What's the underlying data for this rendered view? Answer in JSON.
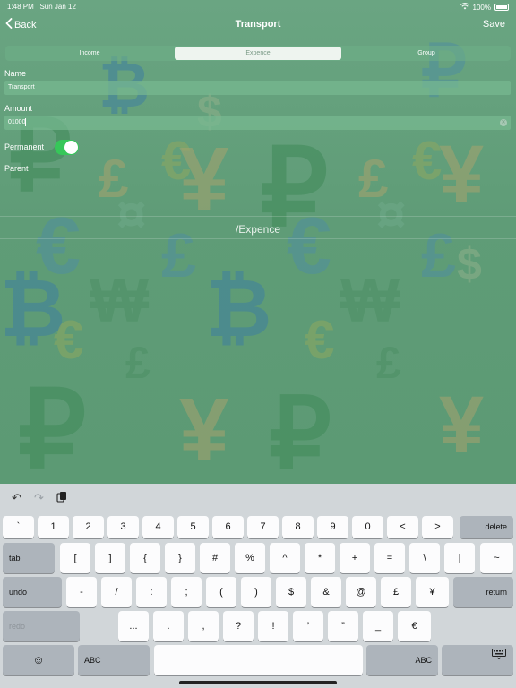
{
  "status": {
    "time": "1:48 PM",
    "date": "Sun Jan 12",
    "battery": "100%"
  },
  "nav": {
    "back_label": "Back",
    "title": "Transport",
    "save_label": "Save"
  },
  "segments": {
    "income": "Income",
    "expense": "Expence",
    "group": "Group",
    "selected": "Expence"
  },
  "form": {
    "name_label": "Name",
    "name_value": "Transport",
    "amount_label": "Amount",
    "amount_value": "01000",
    "permanent_label": "Permanent",
    "permanent_on": true,
    "parent_label": "Parent"
  },
  "parent_path": "/Expence",
  "background_symbols": [
    "₽",
    "€",
    "¥",
    "£",
    "₿",
    "$",
    "¤",
    "₩"
  ],
  "keyboard": {
    "row1": [
      "`",
      "1",
      "2",
      "3",
      "4",
      "5",
      "6",
      "7",
      "8",
      "9",
      "0",
      "<",
      ">"
    ],
    "delete": "delete",
    "tab": "tab",
    "row2": [
      "[",
      "]",
      "{",
      "}",
      "#",
      "%",
      "^",
      "*",
      "+",
      "=",
      "\\",
      "|",
      "~"
    ],
    "undo": "undo",
    "row3": [
      "-",
      "/",
      ":",
      ";",
      "(",
      ")",
      "$",
      "&",
      "@",
      "£",
      "¥"
    ],
    "return": "return",
    "redo": "redo",
    "row4": [
      "...",
      ".",
      ",",
      "?",
      "!",
      "’",
      "”",
      "_",
      "€"
    ],
    "abc_left": "ABC",
    "abc_right": "ABC"
  },
  "colors": {
    "accent_green": "#36c759",
    "background_green": "#5f9c77",
    "keyboard_bg": "#d1d6d9"
  }
}
